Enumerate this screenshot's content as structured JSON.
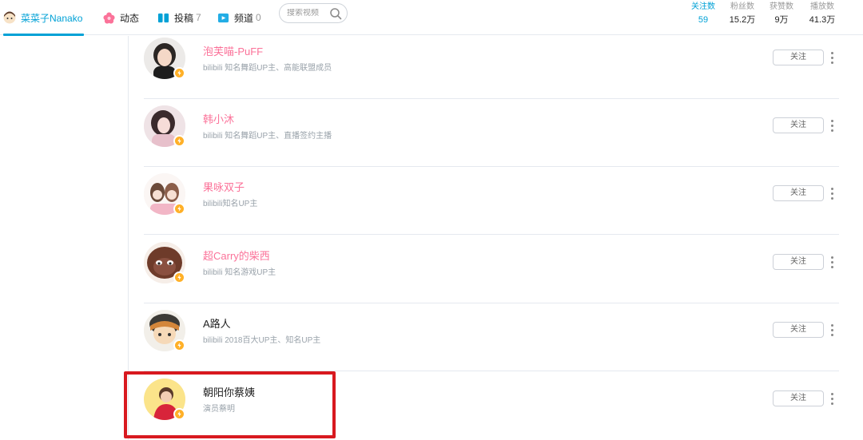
{
  "nav": {
    "user_name": "菜菜子Nanako",
    "dynamic_label": "动态",
    "post_label": "投稿",
    "post_count": "7",
    "channel_label": "频道",
    "channel_count": "0",
    "search_placeholder": "搜索视频"
  },
  "stats": [
    {
      "label": "关注数",
      "value": "59"
    },
    {
      "label": "粉丝数",
      "value": "15.2万"
    },
    {
      "label": "获赞数",
      "value": "9万"
    },
    {
      "label": "播放数",
      "value": "41.3万"
    }
  ],
  "follow_list": [
    {
      "name": "泡芙喵-PuFF",
      "desc": "bilibili 知名舞蹈UP主、高能联盟成员",
      "button": "关注",
      "vip": true
    },
    {
      "name": "韩小沐",
      "desc": "bilibili 知名舞蹈UP主、直播签约主播",
      "button": "关注",
      "vip": true
    },
    {
      "name": "果咏双子",
      "desc": "bilibili知名UP主",
      "button": "关注",
      "vip": true
    },
    {
      "name": "超Carry的柴西",
      "desc": "bilibili 知名游戏UP主",
      "button": "关注",
      "vip": true
    },
    {
      "name": "A路人",
      "desc": "bilibili 2018百大UP主、知名UP主",
      "button": "关注",
      "vip": false
    },
    {
      "name": "朝阳你蔡姨",
      "desc": "演员蔡明",
      "button": "关注",
      "vip": false
    }
  ],
  "colors": {
    "accent": "#00a1d6",
    "vip_name": "#fb7299",
    "verify_badge": "#ffb027",
    "highlight_box": "#d8191f"
  }
}
